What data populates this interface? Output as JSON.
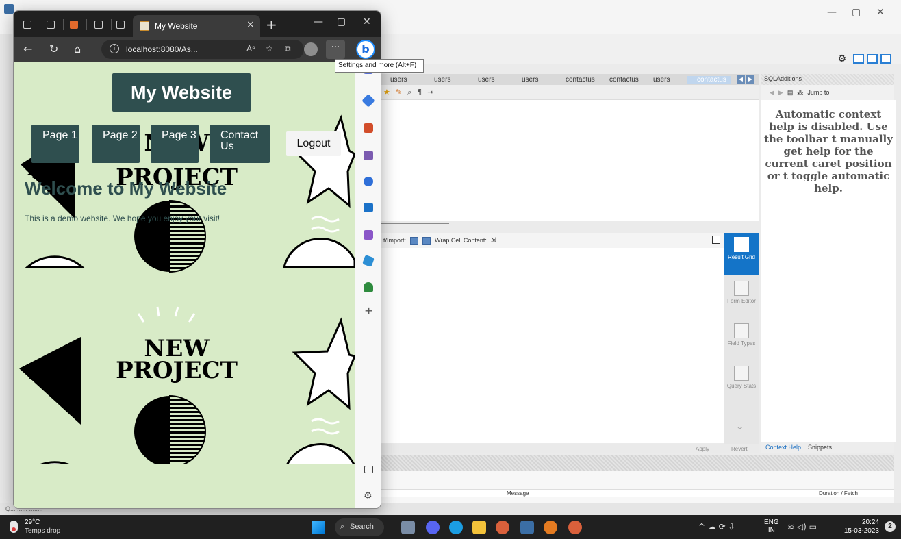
{
  "workbench": {
    "window_controls": {
      "minimize": "—",
      "maximize": "▢",
      "close": "✕"
    },
    "query_tabs": [
      {
        "label": "users",
        "active": false
      },
      {
        "label": "users",
        "active": false
      },
      {
        "label": "users",
        "active": false
      },
      {
        "label": "users",
        "active": false
      },
      {
        "label": "contactus",
        "active": false
      },
      {
        "label": "contactus",
        "active": false
      },
      {
        "label": "users",
        "active": false
      },
      {
        "label": "contactus",
        "active": true
      }
    ],
    "result_toolbar": {
      "export_label": "t/Import:",
      "wrap_label": "Wrap Cell Content:"
    },
    "side_panel": [
      {
        "label": "Result Grid",
        "active": true
      },
      {
        "label": "Form Editor",
        "active": false
      },
      {
        "label": "Field Types",
        "active": false
      },
      {
        "label": "Query Stats",
        "active": false
      }
    ],
    "apply_label": "Apply",
    "revert_label": "Revert",
    "sql_additions": {
      "header": "SQLAdditions",
      "jump_to": "Jump to",
      "context_help_text": "Automatic context help is disabled. Use the toolbar t manually get help for the current caret position or t toggle automatic help.",
      "tabs": {
        "context_help": "Context Help",
        "snippets": "Snippets"
      }
    },
    "output": {
      "col_message": "Message",
      "col_duration": "Duration / Fetch"
    },
    "status_text": "Q... ...... ........"
  },
  "browser": {
    "tab_title": "My Website",
    "tab_close": "×",
    "new_tab": "+",
    "window_controls": {
      "minimize": "—",
      "maximize": "▢",
      "close": "✕"
    },
    "nav": {
      "back": "←",
      "refresh": "↻",
      "home": "⌂"
    },
    "url": "localhost:8080/As...",
    "more_label": "···",
    "copilot_label": "b",
    "tooltip": "Settings and more (Alt+F)",
    "sidebar_plus": "+",
    "sidebar_settings": "⚙"
  },
  "site": {
    "title": "My Website",
    "nav": {
      "page1": "Page 1",
      "page2": "Page 2",
      "page3": "Page 3",
      "contact": "Contact Us",
      "logout": "Logout"
    },
    "heading": "Welcome to My Website",
    "paragraph": "This is a demo website. We hope you enjoy your visit!",
    "bg_text_line1": "NEW",
    "bg_text_line2": "PROJECT"
  },
  "taskbar": {
    "temperature": "29°C",
    "weather": "Temps drop",
    "search_label": "Search",
    "language_line1": "ENG",
    "language_line2": "IN",
    "time": "20:24",
    "date": "15-03-2023",
    "notifications": "2"
  }
}
